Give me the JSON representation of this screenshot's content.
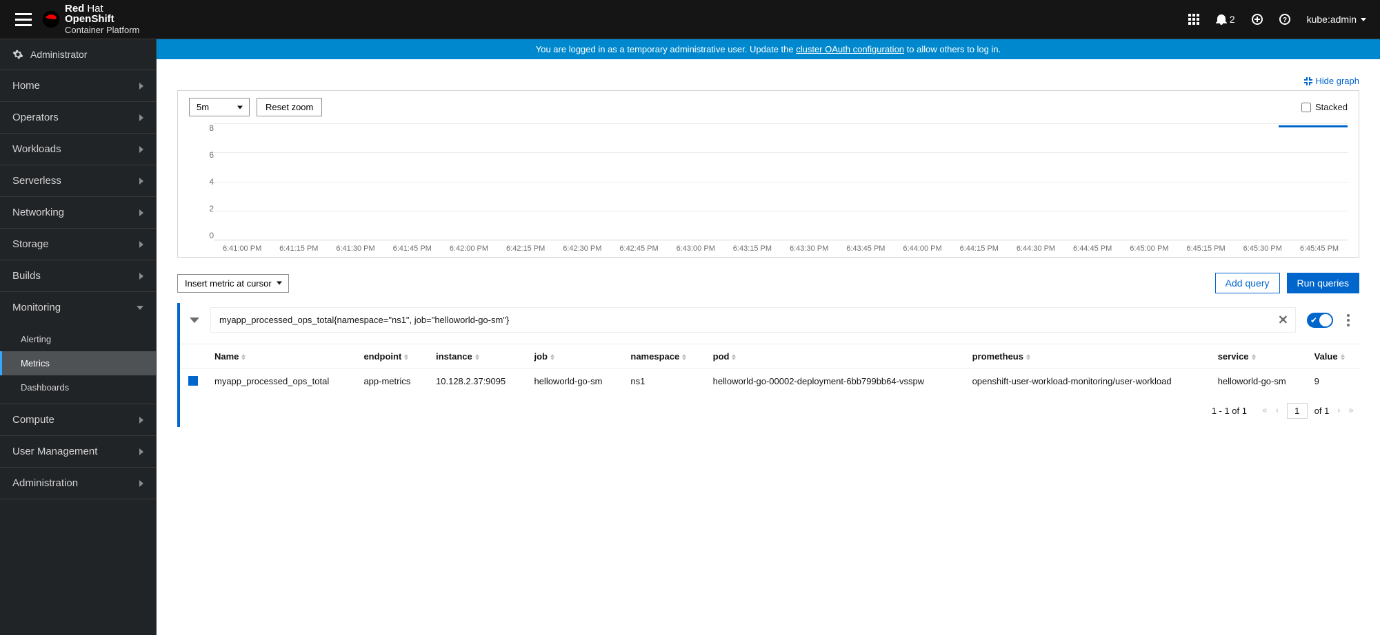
{
  "brand": {
    "l1a": "Red",
    "l1b": "Hat",
    "l2": "OpenShift",
    "l3": "Container Platform"
  },
  "header": {
    "notif_count": "2",
    "user": "kube:admin"
  },
  "perspective": {
    "label": "Administrator"
  },
  "nav": {
    "home": "Home",
    "operators": "Operators",
    "workloads": "Workloads",
    "serverless": "Serverless",
    "networking": "Networking",
    "storage": "Storage",
    "builds": "Builds",
    "monitoring": "Monitoring",
    "compute": "Compute",
    "user_mgmt": "User Management",
    "administration": "Administration",
    "monitoring_sub": {
      "alerting": "Alerting",
      "metrics": "Metrics",
      "dashboards": "Dashboards"
    }
  },
  "banner": {
    "pre": "You are logged in as a temporary administrative user. Update the ",
    "link": "cluster OAuth configuration",
    "post": " to allow others to log in."
  },
  "graph": {
    "hide": "Hide graph",
    "time_range": "5m",
    "reset": "Reset zoom",
    "stacked": "Stacked"
  },
  "chart_data": {
    "type": "line",
    "title": "",
    "ylabel": "",
    "xlabel": "",
    "ylim": [
      0,
      8
    ],
    "y_ticks": [
      "8",
      "6",
      "4",
      "2",
      "0"
    ],
    "x_ticks": [
      "6:41:00 PM",
      "6:41:15 PM",
      "6:41:30 PM",
      "6:41:45 PM",
      "6:42:00 PM",
      "6:42:15 PM",
      "6:42:30 PM",
      "6:42:45 PM",
      "6:43:00 PM",
      "6:43:15 PM",
      "6:43:30 PM",
      "6:43:45 PM",
      "6:44:00 PM",
      "6:44:15 PM",
      "6:44:30 PM",
      "6:44:45 PM",
      "6:45:00 PM",
      "6:45:15 PM",
      "6:45:30 PM",
      "6:45:45 PM"
    ],
    "series": [
      {
        "name": "myapp_processed_ops_total",
        "color": "#06c",
        "x": [
          "6:45:15 PM",
          "6:45:45 PM"
        ],
        "values": [
          9,
          9
        ]
      }
    ]
  },
  "query_toolbar": {
    "insert": "Insert metric at cursor",
    "add": "Add query",
    "run": "Run queries"
  },
  "query": {
    "text": "myapp_processed_ops_total{namespace=\"ns1\", job=\"helloworld-go-sm\"}"
  },
  "table": {
    "headers": {
      "name": "Name",
      "endpoint": "endpoint",
      "instance": "instance",
      "job": "job",
      "namespace": "namespace",
      "pod": "pod",
      "prometheus": "prometheus",
      "service": "service",
      "value": "Value"
    },
    "rows": [
      {
        "name": "myapp_processed_ops_total",
        "endpoint": "app-metrics",
        "instance": "10.128.2.37:9095",
        "job": "helloworld-go-sm",
        "namespace": "ns1",
        "pod": "helloworld-go-00002-deployment-6bb799bb64-vsspw",
        "prometheus": "openshift-user-workload-monitoring/user-workload",
        "service": "helloworld-go-sm",
        "value": "9"
      }
    ]
  },
  "pagination": {
    "range": "1 - 1 of 1",
    "page": "1",
    "of": "of 1"
  }
}
